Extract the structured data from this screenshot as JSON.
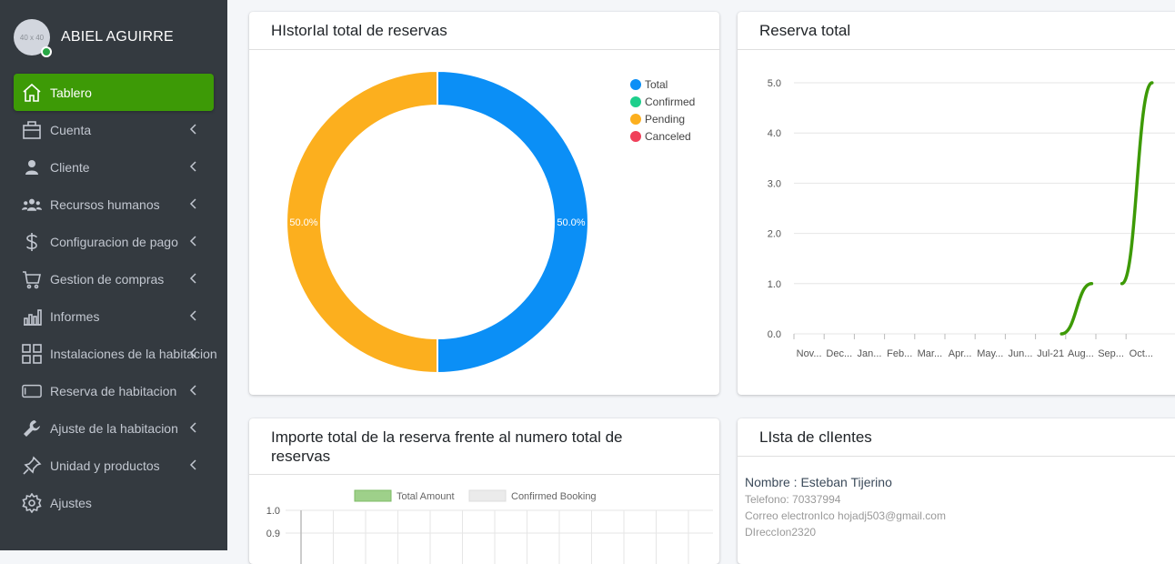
{
  "user": {
    "name": "ABIEL AGUIRRE",
    "avatar_text": "40 x 40"
  },
  "sidebar": {
    "items": [
      {
        "label": "Tablero",
        "icon": "home-icon",
        "active": true,
        "has_chevron": false
      },
      {
        "label": "Cuenta",
        "icon": "briefcase-icon",
        "active": false,
        "has_chevron": true
      },
      {
        "label": "Cliente",
        "icon": "user-icon",
        "active": false,
        "has_chevron": true
      },
      {
        "label": "Recursos humanos",
        "icon": "users-icon",
        "active": false,
        "has_chevron": true
      },
      {
        "label": "Conﬁguracion de pago",
        "icon": "dollar-icon",
        "active": false,
        "has_chevron": true
      },
      {
        "label": "Gestion de compras",
        "icon": "cart-icon",
        "active": false,
        "has_chevron": true
      },
      {
        "label": "Informes",
        "icon": "bar-chart-icon",
        "active": false,
        "has_chevron": true
      },
      {
        "label": "Instalaciones de la habitacion",
        "icon": "grid-icon",
        "active": false,
        "has_chevron": true
      },
      {
        "label": "Reserva de habitacion",
        "icon": "tablet-icon",
        "active": false,
        "has_chevron": true
      },
      {
        "label": "Ajuste de la habitacion",
        "icon": "wrench-icon",
        "active": false,
        "has_chevron": true
      },
      {
        "label": "Unidad y productos",
        "icon": "pin-icon",
        "active": false,
        "has_chevron": true
      },
      {
        "label": "Ajustes",
        "icon": "gear-icon",
        "active": false,
        "has_chevron": false
      }
    ]
  },
  "cards": {
    "history": {
      "title": "HIstorIal total de reservas"
    },
    "total": {
      "title": "Reserva total"
    },
    "importe": {
      "title": "Importe total de la reserva frente al numero total de reservas"
    },
    "clients": {
      "title": "LIsta de clIentes"
    }
  },
  "clients": [
    {
      "name": "Nombre : Esteban Tijerino",
      "phone": "Telefono: 70337994",
      "email": "Correo electronIco hojadj503@gmail.com",
      "address": "DIreccIon2320"
    }
  ],
  "colors": {
    "sidebar_bg": "#343a40",
    "active": "#3d9a06",
    "total": "#0b8ff6",
    "confirmed": "#1ecf8c",
    "pending": "#fcaf1e",
    "canceled": "#f0405a",
    "line": "#3d9a06"
  },
  "chart_data": [
    {
      "type": "pie",
      "variant": "doughnut",
      "title": "HIstorIal total de reservas",
      "labels": [
        "Total",
        "Confirmed",
        "Pending",
        "Canceled"
      ],
      "values": [
        50,
        0,
        50,
        0
      ],
      "value_labels": [
        "50.0%",
        "",
        "50.0%",
        ""
      ],
      "legend": "top-right"
    },
    {
      "type": "line",
      "title": "Reserva total",
      "categories": [
        "Nov...",
        "Dec...",
        "Jan...",
        "Feb...",
        "Mar...",
        "Apr...",
        "May...",
        "Jun...",
        "Jul-21",
        "Aug...",
        "Sep...",
        "Oct..."
      ],
      "series": [
        {
          "values": [
            null,
            null,
            null,
            null,
            null,
            null,
            null,
            null,
            0,
            1,
            1,
            5
          ]
        }
      ],
      "ylim": [
        0,
        5
      ],
      "yticks": [
        "0.0",
        "1.0",
        "2.0",
        "3.0",
        "4.0",
        "5.0"
      ],
      "grid": true
    },
    {
      "type": "bar",
      "title": "Importe total de la reserva frente al numero total de reservas",
      "series": [
        {
          "name": "Total Amount"
        },
        {
          "name": "Confirmed Booking"
        }
      ],
      "yticks_visible": [
        "1.0",
        "0.9"
      ],
      "legend": "top-center",
      "grid": true
    }
  ]
}
